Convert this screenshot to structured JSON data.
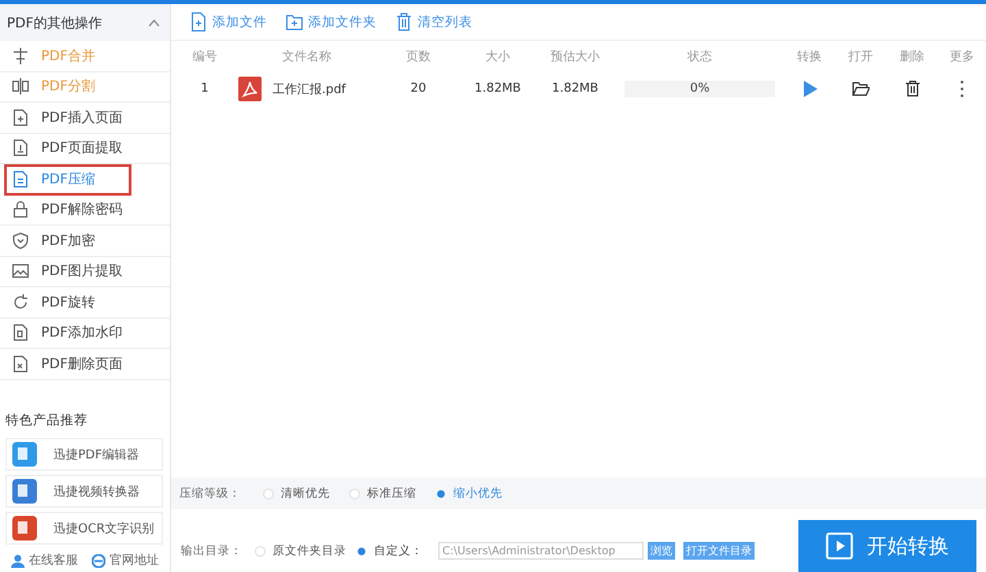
{
  "sidebar": {
    "title": "PDF的其他操作",
    "expanded": true,
    "items": [
      {
        "label": "PDF合并",
        "kind": "merge",
        "highlighted": true,
        "selected": false
      },
      {
        "label": "PDF分割",
        "kind": "split",
        "highlighted": true,
        "selected": false
      },
      {
        "label": "PDF插入页面",
        "kind": "insert",
        "highlighted": false,
        "selected": false
      },
      {
        "label": "PDF页面提取",
        "kind": "extract",
        "highlighted": false,
        "selected": false
      },
      {
        "label": "PDF压缩",
        "kind": "compress",
        "highlighted": false,
        "selected": true
      },
      {
        "label": "PDF解除密码",
        "kind": "lock",
        "highlighted": false,
        "selected": false
      },
      {
        "label": "PDF加密",
        "kind": "shield",
        "highlighted": false,
        "selected": false
      },
      {
        "label": "PDF图片提取",
        "kind": "image",
        "highlighted": false,
        "selected": false
      },
      {
        "label": "PDF旋转",
        "kind": "rotate",
        "highlighted": false,
        "selected": false
      },
      {
        "label": "PDF添加水印",
        "kind": "watermark",
        "highlighted": false,
        "selected": false
      },
      {
        "label": "PDF删除页面",
        "kind": "delete",
        "highlighted": false,
        "selected": false
      }
    ],
    "products_title": "特色产品推荐",
    "products": [
      {
        "label": "迅捷PDF编辑器",
        "color": "#2f9be8"
      },
      {
        "label": "迅捷视频转换器",
        "color": "#3a7fd6"
      },
      {
        "label": "迅捷OCR文字识别",
        "color": "#d9472b"
      }
    ],
    "footer": [
      "在线客服",
      "官网地址"
    ]
  },
  "toolbar": [
    "添加文件",
    "添加文件夹",
    "清空列表"
  ],
  "table": {
    "columns": [
      "编号",
      "文件名称",
      "页数",
      "大小",
      "预估大小",
      "状态",
      "转换",
      "打开",
      "删除",
      "更多"
    ],
    "rows": [
      {
        "index": "1",
        "name": "工作汇报.pdf",
        "pages": "20",
        "size": "1.82MB",
        "estimated": "1.82MB",
        "status": "0%"
      }
    ]
  },
  "compression": {
    "label": "压缩等级：",
    "options": [
      {
        "label": "清晰优先",
        "selected": false
      },
      {
        "label": "标准压缩",
        "selected": false
      },
      {
        "label": "缩小优先",
        "selected": true
      }
    ]
  },
  "output": {
    "label": "输出目录：",
    "options": [
      {
        "label": "原文件夹目录",
        "selected": false
      },
      {
        "label": "自定义：",
        "selected": true
      }
    ],
    "path": "C:\\Users\\Administrator\\Desktop",
    "browse": "浏览",
    "open_dir": "打开文件目录"
  },
  "start_button": "开始转换"
}
